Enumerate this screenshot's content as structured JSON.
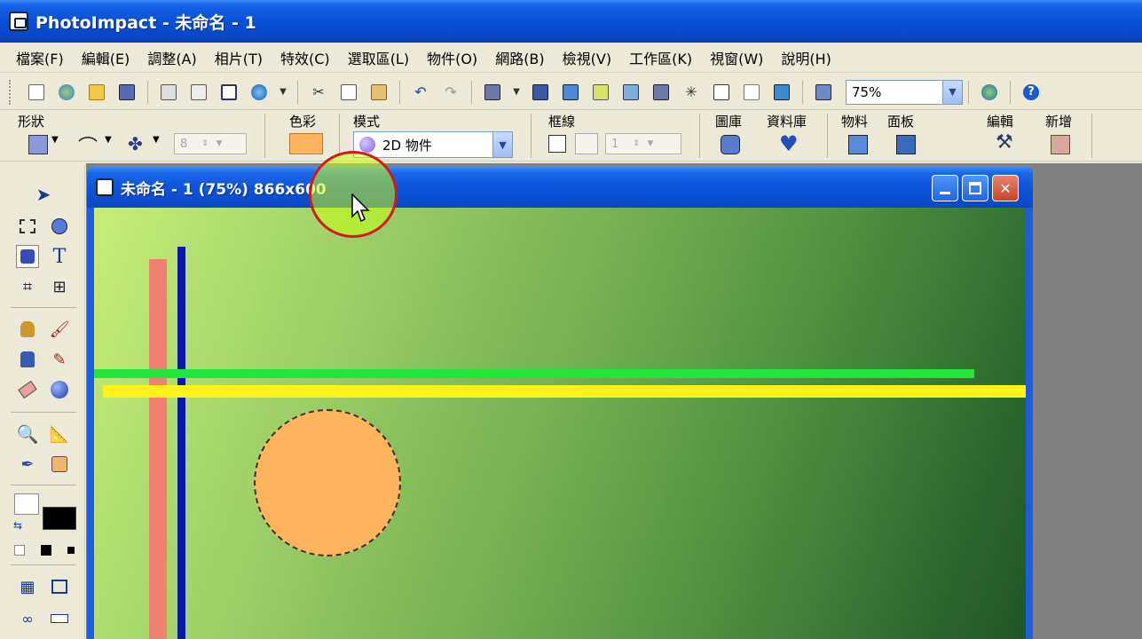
{
  "window": {
    "title": "PhotoImpact - 未命名 - 1"
  },
  "menu": [
    "檔案(F)",
    "編輯(E)",
    "調整(A)",
    "相片(T)",
    "特效(C)",
    "選取區(L)",
    "物件(O)",
    "網路(B)",
    "檢視(V)",
    "工作區(K)",
    "視窗(W)",
    "說明(H)"
  ],
  "toolbar": {
    "zoom": "75%"
  },
  "attributes": {
    "shape_label": "形狀",
    "color_label": "色彩",
    "mode_label": "模式",
    "mode_value": "2D 物件",
    "border_label": "框線",
    "gallery_label": "圖庫",
    "database_label": "資料庫",
    "material_label": "物料",
    "panel_label": "面板",
    "edit_label": "編輯",
    "new_label": "新增",
    "line_count": "8",
    "border_width": "1"
  },
  "document": {
    "title": "未命名 - 1 (75%) 866x600"
  },
  "colors": {
    "object_fill": "#fdb45c",
    "salmon_bar": "#f08070",
    "blue_bar": "#0a1aa8",
    "green_bar": "#22e43a",
    "yellow_bar": "#fff21a",
    "title_blue": "#0a4fd6"
  }
}
